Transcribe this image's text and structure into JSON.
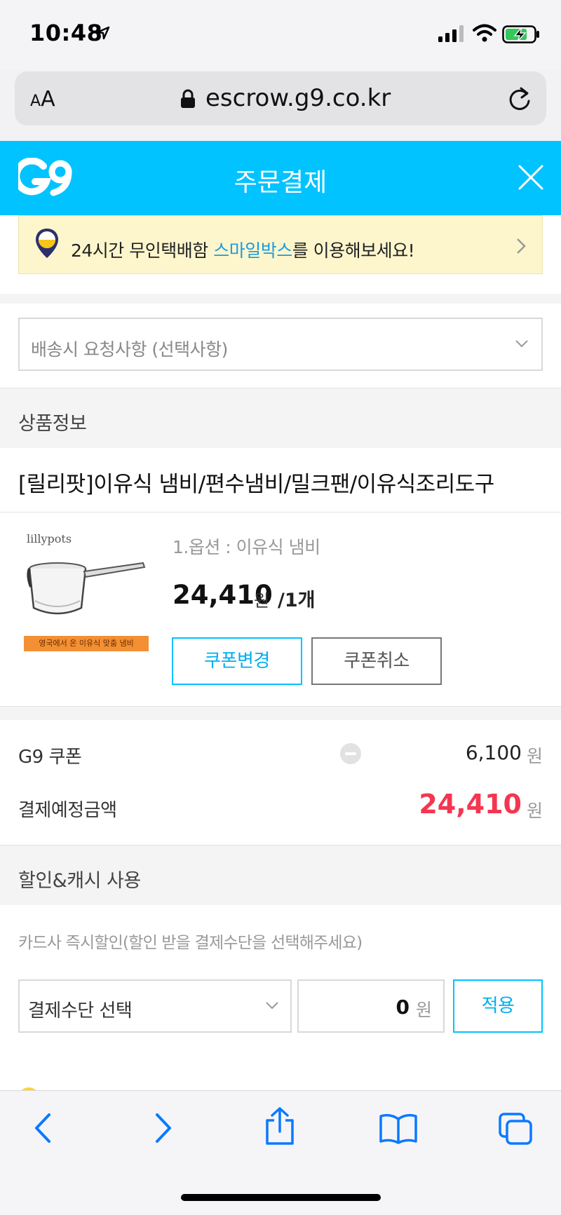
{
  "status_bar": {
    "time": "10:48"
  },
  "browser": {
    "text_size_label": "AA",
    "url": "escrow.g9.co.kr"
  },
  "header": {
    "title": "주문결제"
  },
  "banner": {
    "text_before": "24시간 무인택배함 ",
    "highlight": "스마일박스",
    "text_after": "를 이용해보세요!"
  },
  "delivery_request": {
    "placeholder": "배송시 요청사항 (선택사항)"
  },
  "product_section": {
    "heading": "상품정보",
    "title": "[릴리팟]이유식 냄비/편수냄비/밀크팬/이유식조리도구",
    "thumb_brand": "lillypots",
    "thumb_tag": "영국에서 온 이유식 맞춤 냄비",
    "option": "1.옵션 : 이유식 냄비",
    "price": "24,410",
    "price_unit": "원",
    "quantity": "/1개",
    "coupon_change_label": "쿠폰변경",
    "coupon_cancel_label": "쿠폰취소"
  },
  "summary": {
    "coupon_label": "G9 쿠폰",
    "coupon_amount": "6,100",
    "total_label": "결제예정금액",
    "total_amount": "24,410",
    "won": "원"
  },
  "discount_section": {
    "heading": "할인&캐시 사용",
    "card_note": "카드사 즉시할인(할인 받을 결제수단을 선택해주세요)",
    "payment_select": "결제수단 선택",
    "amount_value": "0",
    "amount_unit": "원",
    "apply_label": "적용"
  },
  "colors": {
    "brand": "#00c3ff",
    "price_red": "#f43650",
    "banner_bg": "#fdf6cc",
    "link_blue": "#1a9bde"
  }
}
